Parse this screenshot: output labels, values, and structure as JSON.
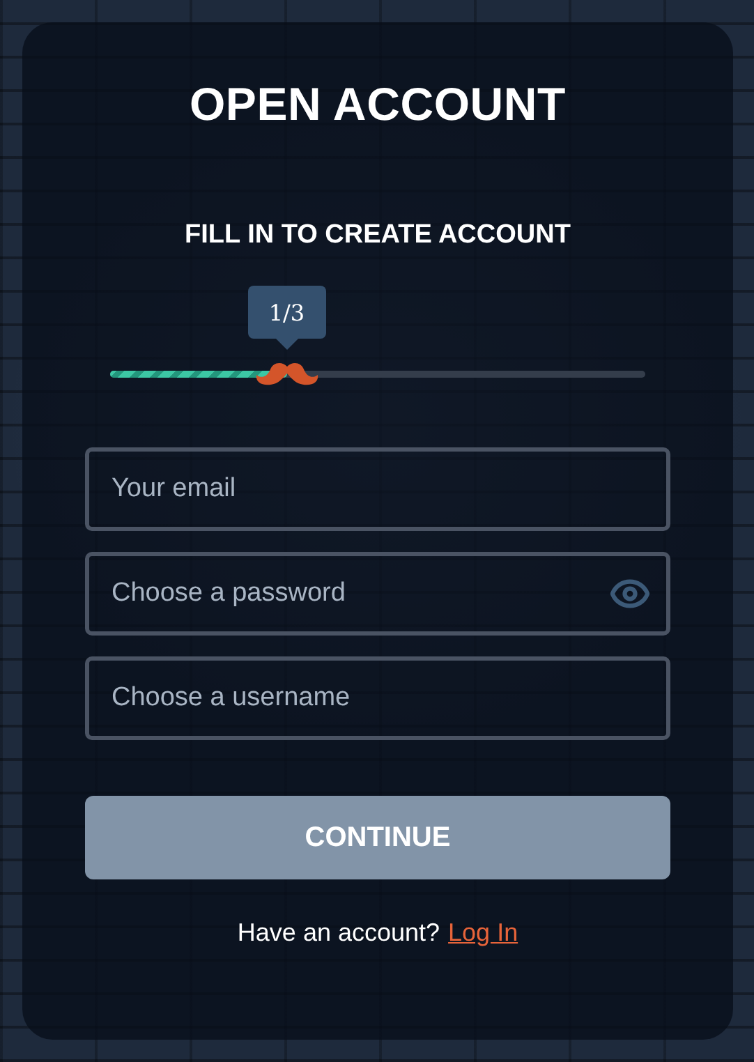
{
  "title": "OPEN ACCOUNT",
  "subtitle": "FILL IN TO CREATE ACCOUNT",
  "progress": {
    "step_label": "1/3",
    "level": 0.33
  },
  "fields": [
    {
      "kind": "text",
      "placeholder": "Your email"
    },
    {
      "kind": "password",
      "placeholder": "Choose a password"
    },
    {
      "kind": "text",
      "placeholder": "Choose a username"
    }
  ],
  "continue_button": {
    "label": "CONTINUE",
    "disabled": true
  },
  "footer": {
    "text": "Have an account?",
    "link": "Log In"
  }
}
